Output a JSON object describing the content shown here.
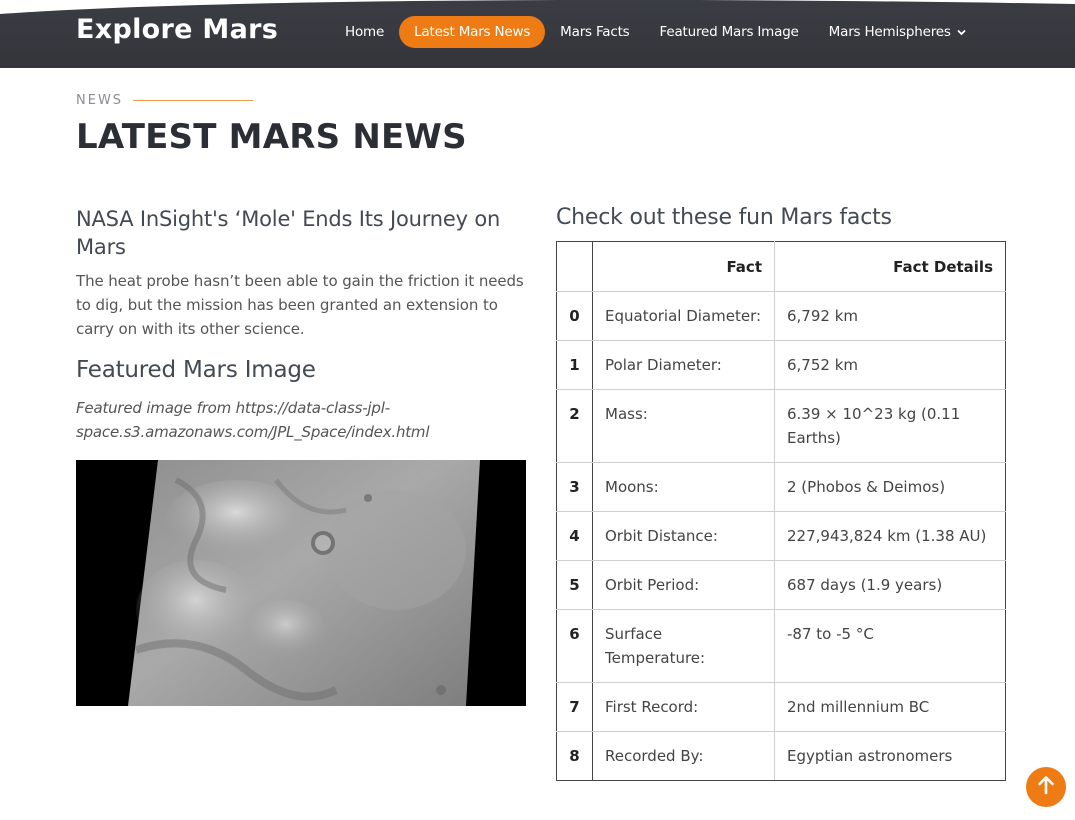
{
  "header": {
    "logo": "Explore Mars",
    "nav": [
      {
        "label": "Home",
        "active": false
      },
      {
        "label": "Latest Mars News",
        "active": true
      },
      {
        "label": "Mars Facts",
        "active": false
      },
      {
        "label": "Featured Mars Image",
        "active": false
      },
      {
        "label": "Mars Hemispheres",
        "active": false,
        "icon": "chevron-down-icon"
      }
    ]
  },
  "section": {
    "kicker": "NEWS",
    "title": "LATEST MARS NEWS"
  },
  "news": {
    "title": "NASA InSight's ‘Mole' Ends Its Journey on Mars",
    "body": "The heat probe hasn’t been able to gain the friction it needs to dig, but the mission has been granted an extension to carry on with its other science."
  },
  "featured": {
    "title": "Featured Mars Image",
    "caption": "Featured image from https://data-class-jpl-space.s3.amazonaws.com/JPL_Space/index.html"
  },
  "facts": {
    "title": "Check out these fun Mars facts",
    "columns": [
      "",
      "Fact",
      "Fact Details"
    ],
    "rows": [
      [
        "0",
        "Equatorial Diameter:",
        "6,792 km"
      ],
      [
        "1",
        "Polar Diameter:",
        "6,752 km"
      ],
      [
        "2",
        "Mass:",
        "6.39 × 10^23 kg (0.11 Earths)"
      ],
      [
        "3",
        "Moons:",
        "2 (Phobos & Deimos)"
      ],
      [
        "4",
        "Orbit Distance:",
        "227,943,824 km (1.38 AU)"
      ],
      [
        "5",
        "Orbit Period:",
        "687 days (1.9 years)"
      ],
      [
        "6",
        "Surface Temperature:",
        "-87 to -5 °C"
      ],
      [
        "7",
        "First Record:",
        "2nd millennium BC"
      ],
      [
        "8",
        "Recorded By:",
        "Egyptian astronomers"
      ]
    ]
  },
  "back_to_top": {
    "icon": "arrow-up-icon"
  },
  "colors": {
    "header_bg": "#37393f",
    "accent": "#ee7b13",
    "title": "#2c2e35"
  }
}
